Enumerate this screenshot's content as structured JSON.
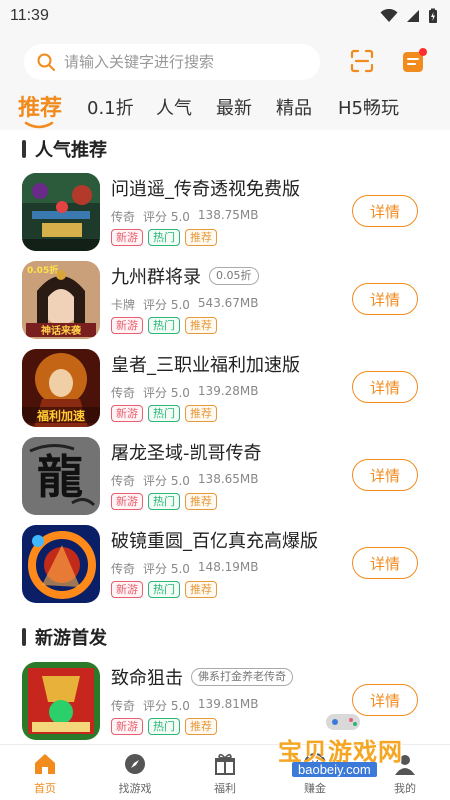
{
  "status": {
    "time": "11:39"
  },
  "search": {
    "placeholder": "请输入关键字进行搜索",
    "value": ""
  },
  "tabs": [
    {
      "label": "推荐",
      "active": true
    },
    {
      "label": "0.1折"
    },
    {
      "label": "人气"
    },
    {
      "label": "最新"
    },
    {
      "label": "精品"
    },
    {
      "label": "H5畅玩"
    }
  ],
  "sections": {
    "popular": {
      "title": "人气推荐"
    },
    "new_games": {
      "title": "新游首发"
    }
  },
  "games": [
    {
      "name": "问逍遥_传奇透视免费版",
      "category": "传奇",
      "rating": "评分 5.0",
      "size": "138.75MB",
      "tags": [
        "新游",
        "热门",
        "推荐"
      ],
      "button": "详情",
      "icon": "game-art-xiaoyao-icon"
    },
    {
      "name": "九州群将录",
      "discount": "0.05折",
      "category": "卡牌",
      "rating": "评分 5.0",
      "size": "543.67MB",
      "tags": [
        "新游",
        "热门",
        "推荐"
      ],
      "button": "详情",
      "icon": "game-art-jiuzhou-icon",
      "icon_text": "0.05折"
    },
    {
      "name": "皇者_三职业福利加速版",
      "category": "传奇",
      "rating": "评分 5.0",
      "size": "139.28MB",
      "tags": [
        "新游",
        "热门",
        "推荐"
      ],
      "button": "详情",
      "icon": "game-art-huangzhe-icon"
    },
    {
      "name": "屠龙圣域-凯哥传奇",
      "category": "传奇",
      "rating": "评分 5.0",
      "size": "138.65MB",
      "tags": [
        "新游",
        "热门",
        "推荐"
      ],
      "button": "详情",
      "icon": "game-art-tulong-icon"
    },
    {
      "name": "破镜重圆_百亿真充高爆版",
      "category": "传奇",
      "rating": "评分 5.0",
      "size": "148.19MB",
      "tags": [
        "新游",
        "热门",
        "推荐"
      ],
      "button": "详情",
      "icon": "game-art-pojing-icon"
    },
    {
      "name": "致命狙击",
      "desc": "佛系打金养老传奇",
      "category": "传奇",
      "rating": "评分 5.0",
      "size": "139.81MB",
      "tags": [
        "新游",
        "热门",
        "推荐"
      ],
      "button": "详情",
      "icon": "game-art-zhiming-icon"
    }
  ],
  "bottom_nav": [
    {
      "label": "首页",
      "icon": "home-icon",
      "active": true
    },
    {
      "label": "找游戏",
      "icon": "compass-icon"
    },
    {
      "label": "福利",
      "icon": "gift-icon"
    },
    {
      "label": "赚金",
      "icon": "coin-icon"
    },
    {
      "label": "我的",
      "icon": "user-icon"
    }
  ],
  "watermark": {
    "text": "宝贝游戏网",
    "url": "baobeiy.com"
  },
  "colors": {
    "accent": "#f28b1e",
    "tag_new": "#e85f6f",
    "tag_hot": "#2bb673",
    "tag_rec": "#e69a3b"
  }
}
